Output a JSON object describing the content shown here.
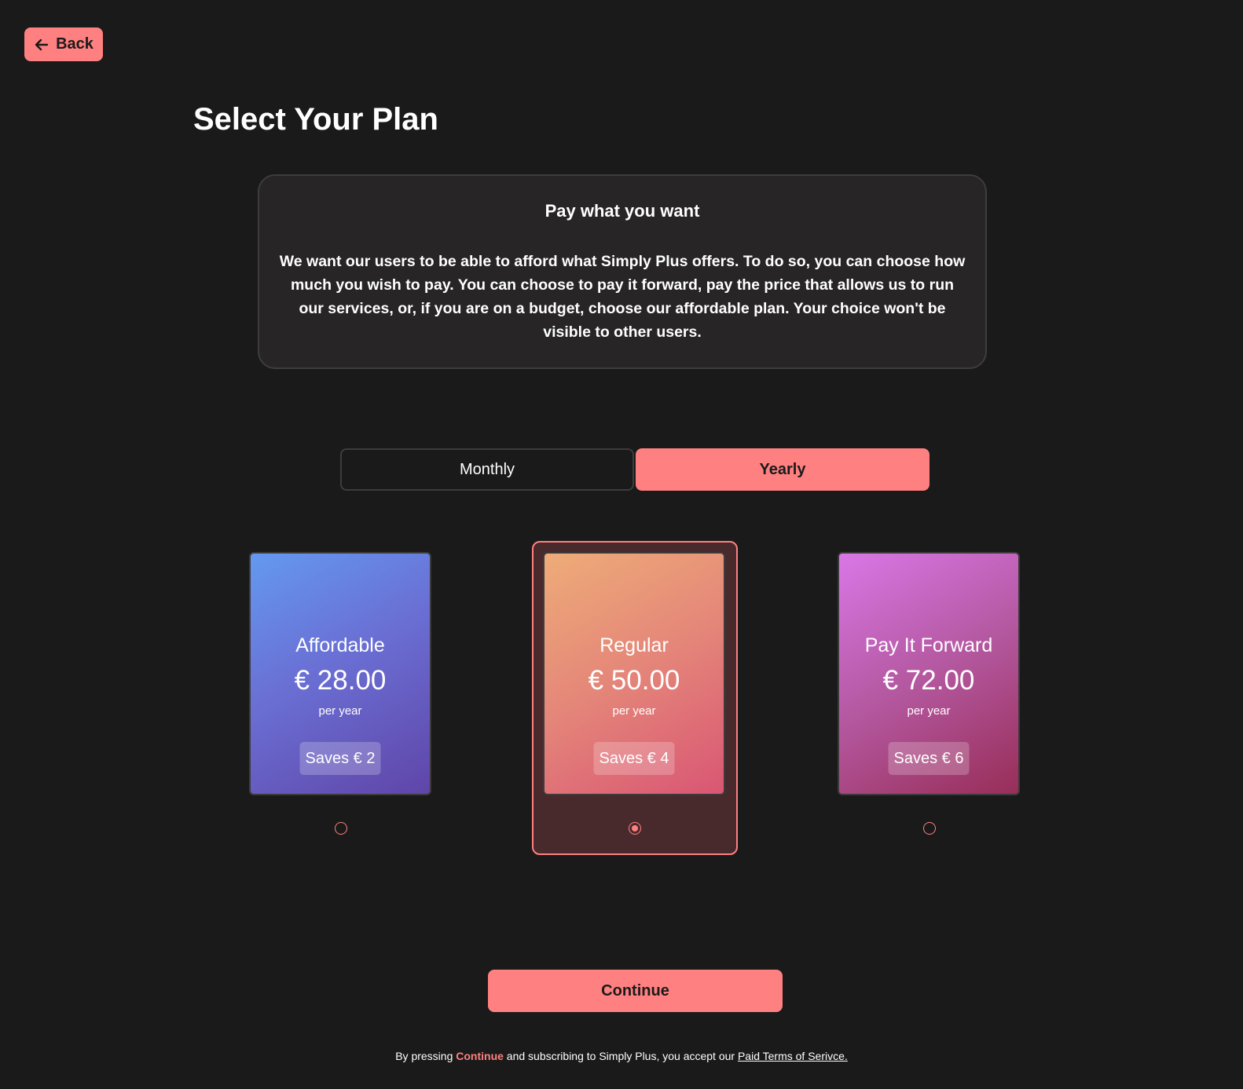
{
  "back": {
    "label": "Back",
    "icon": "arrow-left-icon"
  },
  "page_title": "Select Your Plan",
  "info": {
    "title": "Pay what you want",
    "text": "We want our users to be able to afford what Simply Plus offers. To do so, you can choose how much you wish to pay. You can choose to pay it forward, pay the price that allows us to run our services, or, if you are on a budget, choose our affordable plan. Your choice won't be visible to other users."
  },
  "billing_toggle": {
    "monthly_label": "Monthly",
    "yearly_label": "Yearly",
    "selected": "Yearly"
  },
  "plans": [
    {
      "name": "Affordable",
      "price": "€ 28.00",
      "period": "per year",
      "saves": "Saves € 2",
      "selected": false
    },
    {
      "name": "Regular",
      "price": "€ 50.00",
      "period": "per year",
      "saves": "Saves € 4",
      "selected": true
    },
    {
      "name": "Pay It Forward",
      "price": "€ 72.00",
      "period": "per year",
      "saves": "Saves € 6",
      "selected": false
    }
  ],
  "continue_label": "Continue",
  "footer": {
    "prefix": "By pressing ",
    "highlight": "Continue",
    "middle": " and subscribing to Simply Plus, you accept our ",
    "link": "Paid Terms of Serivce."
  },
  "colors": {
    "background": "#1a1a1a",
    "accent": "#ff8080",
    "panel": "#272526"
  }
}
